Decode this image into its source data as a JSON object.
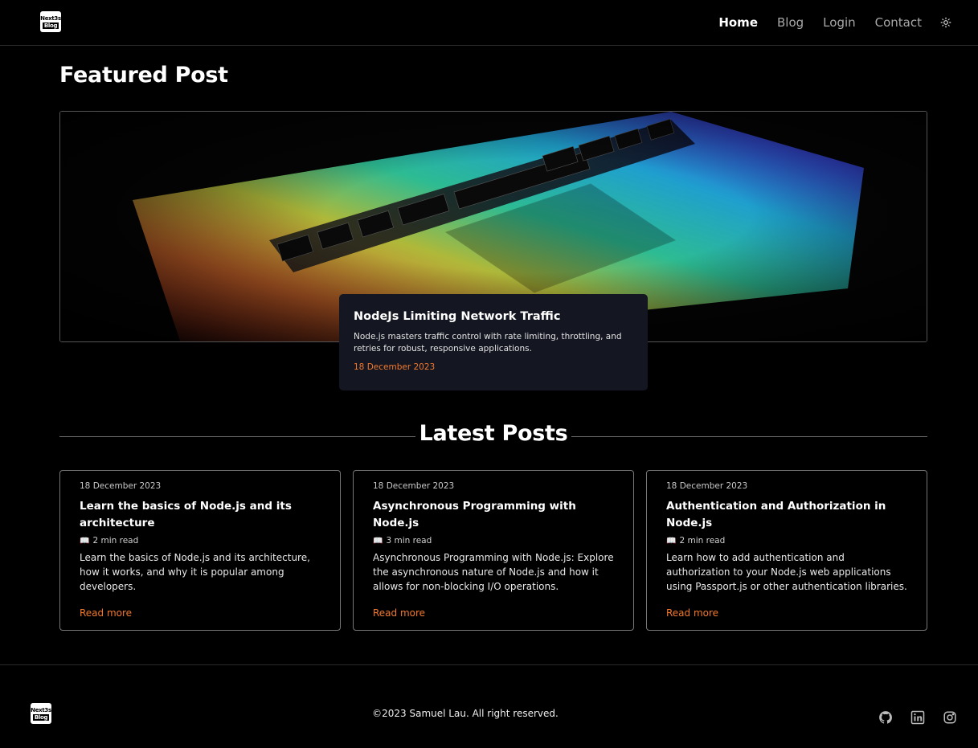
{
  "header": {
    "logo_line1": "Next3s",
    "logo_line2": "Blog",
    "nav": {
      "home": "Home",
      "blog": "Blog",
      "login": "Login",
      "contact": "Contact"
    },
    "theme_icon": "sun-icon"
  },
  "featured": {
    "section_title": "Featured Post",
    "post": {
      "title": "NodeJs Limiting Network Traffic",
      "description": "Node.js masters traffic control with rate limiting, throttling, and retries for robust, responsive applications.",
      "date": "18 December 2023"
    }
  },
  "latest": {
    "section_title": "Latest Posts",
    "posts": [
      {
        "date": "18 December 2023",
        "title": "Learn the basics of Node.js and its architecture",
        "read_time": "2 min read",
        "description": "Learn the basics of Node.js and its architecture, how it works, and why it is popular among developers.",
        "link": "Read more"
      },
      {
        "date": "18 December 2023",
        "title": "Asynchronous Programming with Node.js",
        "read_time": "3 min read",
        "description": "Asynchronous Programming with Node.js: Explore the asynchronous nature of Node.js and how it allows for non-blocking I/O operations.",
        "link": "Read more"
      },
      {
        "date": "18 December 2023",
        "title": "Authentication and Authorization in Node.js",
        "read_time": "2 min read",
        "description": "Learn how to add authentication and authorization to your Node.js web applications using Passport.js or other authentication libraries.",
        "link": "Read more"
      }
    ],
    "read_icon": "open-book-icon"
  },
  "footer": {
    "copyright": "©2023 Samuel Lau. All right reserved.",
    "socials": [
      "github-icon",
      "linkedin-icon",
      "instagram-icon"
    ]
  },
  "colors": {
    "background": "#000000",
    "accent": "#f2782b",
    "card_overlay": "#141722"
  }
}
